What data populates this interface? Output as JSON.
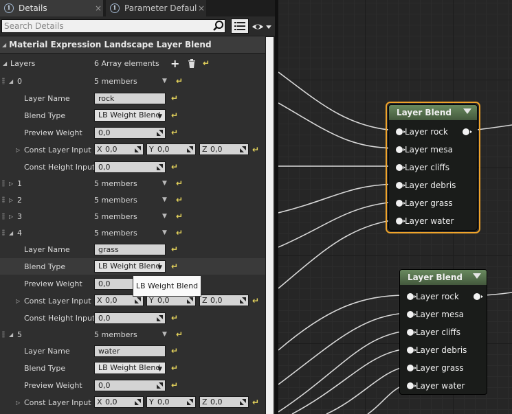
{
  "tabs": [
    {
      "label": "Details",
      "active": true
    },
    {
      "label": "Parameter Defaults",
      "active": false
    }
  ],
  "search": {
    "placeholder": "Search Details"
  },
  "section": {
    "title": "Material Expression Landscape Layer Blend"
  },
  "layers": {
    "label": "Layers",
    "count": "6 Array elements"
  },
  "rows": {
    "idx0": "0",
    "idx1": "1",
    "idx2": "2",
    "idx3": "3",
    "idx4": "4",
    "idx5": "5",
    "members": "5 members",
    "layer_name": "Layer Name",
    "blend_type": "Blend Type",
    "preview_weight": "Preview Weight",
    "const_layer_input": "Const Layer Input",
    "const_height_input": "Const Height Input",
    "name0": "rock",
    "name4": "grass",
    "name5": "water",
    "blend_value": "LB Weight Blend",
    "zero": "0,0",
    "x": "X",
    "y": "Y",
    "z": "Z"
  },
  "tooltip": "LB Weight Blend",
  "nodes": [
    {
      "title": "Layer Blend",
      "pins": [
        "Layer rock",
        "Layer mesa",
        "Layer cliffs",
        "Layer debris",
        "Layer grass",
        "Layer water"
      ],
      "selected": true
    },
    {
      "title": "Layer Blend",
      "pins": [
        "Layer rock",
        "Layer mesa",
        "Layer cliffs",
        "Layer debris",
        "Layer grass",
        "Layer water"
      ],
      "selected": false
    }
  ],
  "colors": {
    "selection": "#f0a42a",
    "node_header": "#5a7a51",
    "reset_arrow": "#e6d45c"
  }
}
